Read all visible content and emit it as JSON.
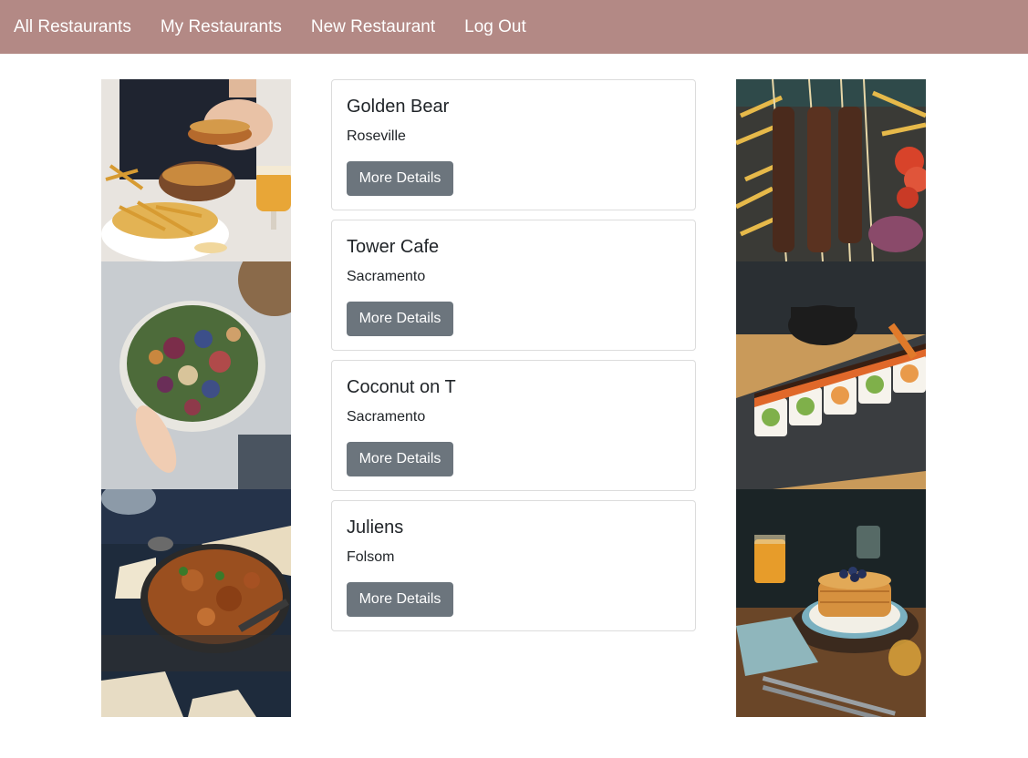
{
  "nav": {
    "items": [
      {
        "label": "All Restaurants"
      },
      {
        "label": "My Restaurants"
      },
      {
        "label": "New Restaurant"
      },
      {
        "label": "Log Out"
      }
    ]
  },
  "restaurants": [
    {
      "name": "Golden Bear",
      "city": "Roseville",
      "button": "More Details"
    },
    {
      "name": "Tower Cafe",
      "city": "Sacramento",
      "button": "More Details"
    },
    {
      "name": "Coconut on T",
      "city": "Sacramento",
      "button": "More Details"
    },
    {
      "name": "Juliens",
      "city": "Folsom",
      "button": "More Details"
    }
  ],
  "colors": {
    "navbar": "#b38985",
    "button": "#6c757d"
  },
  "photos": {
    "left": [
      "burger-fries-photo",
      "salad-platter-photo",
      "curry-pan-photo"
    ],
    "right": [
      "kebab-skewers-photo",
      "sushi-roll-photo",
      "pancakes-photo"
    ]
  }
}
